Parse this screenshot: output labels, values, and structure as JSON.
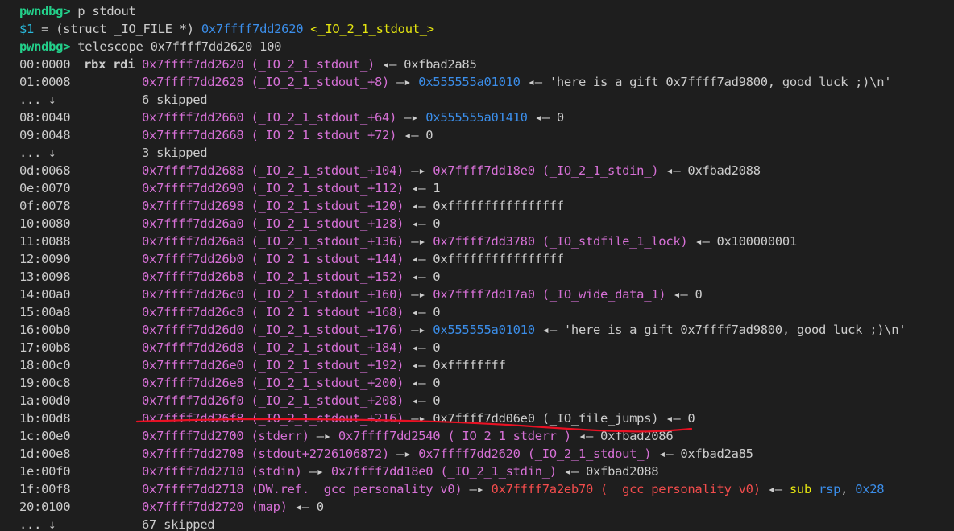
{
  "header": {
    "cmd1_prompt": "pwndbg>",
    "cmd1_text": " p stdout",
    "result_var": "$1",
    "result_mid": " = (struct _IO_FILE *) ",
    "result_addr": "0x7ffff7dd2620",
    "result_sym": " <_IO_2_1_stdout_>",
    "cmd2_prompt": "pwndbg>",
    "cmd2_text": " telescope 0x7ffff7dd2620 100"
  },
  "rows": [
    {
      "idx": "00:0000",
      "regs": "rbx rdi",
      "parts": [
        [
          "mag",
          "0x7ffff7dd2620 (_IO_2_1_stdout_)"
        ],
        [
          "white",
          " ◂— 0xfbad2a85"
        ]
      ]
    },
    {
      "idx": "01:0008",
      "regs": "",
      "parts": [
        [
          "mag",
          "0x7ffff7dd2628 (_IO_2_1_stdout_+8)"
        ],
        [
          "white",
          " —▸ "
        ],
        [
          "blue",
          "0x555555a01010"
        ],
        [
          "white",
          " ◂— 'here is a gift 0x7ffff7ad9800, good luck ;)\\n'"
        ]
      ]
    },
    {
      "idx": "... ↓",
      "skip": true,
      "parts": [
        [
          "white",
          "6 skipped"
        ]
      ]
    },
    {
      "idx": "08:0040",
      "regs": "",
      "parts": [
        [
          "mag",
          "0x7ffff7dd2660 (_IO_2_1_stdout_+64)"
        ],
        [
          "white",
          " —▸ "
        ],
        [
          "blue",
          "0x555555a01410"
        ],
        [
          "white",
          " ◂— 0"
        ]
      ]
    },
    {
      "idx": "09:0048",
      "regs": "",
      "parts": [
        [
          "mag",
          "0x7ffff7dd2668 (_IO_2_1_stdout_+72)"
        ],
        [
          "white",
          " ◂— 0"
        ]
      ]
    },
    {
      "idx": "... ↓",
      "skip": true,
      "parts": [
        [
          "white",
          "3 skipped"
        ]
      ]
    },
    {
      "idx": "0d:0068",
      "regs": "",
      "parts": [
        [
          "mag",
          "0x7ffff7dd2688 (_IO_2_1_stdout_+104)"
        ],
        [
          "white",
          " —▸ "
        ],
        [
          "mag",
          "0x7ffff7dd18e0 (_IO_2_1_stdin_)"
        ],
        [
          "white",
          " ◂— 0xfbad2088"
        ]
      ]
    },
    {
      "idx": "0e:0070",
      "regs": "",
      "parts": [
        [
          "mag",
          "0x7ffff7dd2690 (_IO_2_1_stdout_+112)"
        ],
        [
          "white",
          " ◂— 1"
        ]
      ]
    },
    {
      "idx": "0f:0078",
      "regs": "",
      "parts": [
        [
          "mag",
          "0x7ffff7dd2698 (_IO_2_1_stdout_+120)"
        ],
        [
          "white",
          " ◂— 0xffffffffffffffff"
        ]
      ]
    },
    {
      "idx": "10:0080",
      "regs": "",
      "parts": [
        [
          "mag",
          "0x7ffff7dd26a0 (_IO_2_1_stdout_+128)"
        ],
        [
          "white",
          " ◂— 0"
        ]
      ]
    },
    {
      "idx": "11:0088",
      "regs": "",
      "parts": [
        [
          "mag",
          "0x7ffff7dd26a8 (_IO_2_1_stdout_+136)"
        ],
        [
          "white",
          " —▸ "
        ],
        [
          "mag",
          "0x7ffff7dd3780 (_IO_stdfile_1_lock)"
        ],
        [
          "white",
          " ◂— 0x100000001"
        ]
      ]
    },
    {
      "idx": "12:0090",
      "regs": "",
      "parts": [
        [
          "mag",
          "0x7ffff7dd26b0 (_IO_2_1_stdout_+144)"
        ],
        [
          "white",
          " ◂— 0xffffffffffffffff"
        ]
      ]
    },
    {
      "idx": "13:0098",
      "regs": "",
      "parts": [
        [
          "mag",
          "0x7ffff7dd26b8 (_IO_2_1_stdout_+152)"
        ],
        [
          "white",
          " ◂— 0"
        ]
      ]
    },
    {
      "idx": "14:00a0",
      "regs": "",
      "parts": [
        [
          "mag",
          "0x7ffff7dd26c0 (_IO_2_1_stdout_+160)"
        ],
        [
          "white",
          " —▸ "
        ],
        [
          "mag",
          "0x7ffff7dd17a0 (_IO_wide_data_1)"
        ],
        [
          "white",
          " ◂— 0"
        ]
      ]
    },
    {
      "idx": "15:00a8",
      "regs": "",
      "parts": [
        [
          "mag",
          "0x7ffff7dd26c8 (_IO_2_1_stdout_+168)"
        ],
        [
          "white",
          " ◂— 0"
        ]
      ]
    },
    {
      "idx": "16:00b0",
      "regs": "",
      "parts": [
        [
          "mag",
          "0x7ffff7dd26d0 (_IO_2_1_stdout_+176)"
        ],
        [
          "white",
          " —▸ "
        ],
        [
          "blue",
          "0x555555a01010"
        ],
        [
          "white",
          " ◂— 'here is a gift 0x7ffff7ad9800, good luck ;)\\n'"
        ]
      ]
    },
    {
      "idx": "17:00b8",
      "regs": "",
      "parts": [
        [
          "mag",
          "0x7ffff7dd26d8 (_IO_2_1_stdout_+184)"
        ],
        [
          "white",
          " ◂— 0"
        ]
      ]
    },
    {
      "idx": "18:00c0",
      "regs": "",
      "parts": [
        [
          "mag",
          "0x7ffff7dd26e0 (_IO_2_1_stdout_+192)"
        ],
        [
          "white",
          " ◂— 0xffffffff"
        ]
      ]
    },
    {
      "idx": "19:00c8",
      "regs": "",
      "parts": [
        [
          "mag",
          "0x7ffff7dd26e8 (_IO_2_1_stdout_+200)"
        ],
        [
          "white",
          " ◂— 0"
        ]
      ]
    },
    {
      "idx": "1a:00d0",
      "regs": "",
      "parts": [
        [
          "mag",
          "0x7ffff7dd26f0 (_IO_2_1_stdout_+208)"
        ],
        [
          "white",
          " ◂— 0"
        ]
      ]
    },
    {
      "idx": "1b:00d8",
      "regs": "",
      "highlight": true,
      "parts": [
        [
          "mag",
          "0x7ffff7dd26f8 (_IO_2_1_stdout_+216)"
        ],
        [
          "white",
          " —▸ 0x7ffff7dd06e0 (_IO_file_jumps) ◂— 0"
        ]
      ]
    },
    {
      "idx": "1c:00e0",
      "regs": "",
      "parts": [
        [
          "mag",
          "0x7ffff7dd2700 (stderr)"
        ],
        [
          "white",
          " —▸ "
        ],
        [
          "mag",
          "0x7ffff7dd2540 (_IO_2_1_stderr_)"
        ],
        [
          "white",
          " ◂— 0xfbad2086"
        ]
      ]
    },
    {
      "idx": "1d:00e8",
      "regs": "",
      "parts": [
        [
          "mag",
          "0x7ffff7dd2708 (stdout+2726106872)"
        ],
        [
          "white",
          " —▸ "
        ],
        [
          "mag",
          "0x7ffff7dd2620 (_IO_2_1_stdout_)"
        ],
        [
          "white",
          " ◂— 0xfbad2a85"
        ]
      ]
    },
    {
      "idx": "1e:00f0",
      "regs": "",
      "parts": [
        [
          "mag",
          "0x7ffff7dd2710 (stdin)"
        ],
        [
          "white",
          " —▸ "
        ],
        [
          "mag",
          "0x7ffff7dd18e0 (_IO_2_1_stdin_)"
        ],
        [
          "white",
          " ◂— 0xfbad2088"
        ]
      ]
    },
    {
      "idx": "1f:00f8",
      "regs": "",
      "parts": [
        [
          "mag",
          "0x7ffff7dd2718 (DW.ref.__gcc_personality_v0)"
        ],
        [
          "white",
          " —▸ "
        ],
        [
          "red",
          "0x7ffff7a2eb70 (__gcc_personality_v0)"
        ],
        [
          "white",
          " ◂— "
        ],
        [
          "yel",
          "sub "
        ],
        [
          "blue",
          "rsp"
        ],
        [
          "white",
          ", "
        ],
        [
          "blue",
          "0x28"
        ]
      ]
    },
    {
      "idx": "20:0100",
      "regs": "",
      "parts": [
        [
          "mag",
          "0x7ffff7dd2720 (map)"
        ],
        [
          "white",
          " ◂— 0"
        ]
      ]
    },
    {
      "idx": "... ↓",
      "skip": true,
      "parts": [
        [
          "white",
          "67 skipped"
        ]
      ]
    }
  ],
  "colors": {
    "background": "#1e1e1e",
    "prompt": "#23d18b",
    "magenta": "#d670d6",
    "blue": "#3b8eea",
    "yellow": "#e5e510",
    "red": "#f14c4c",
    "white": "#cccccc",
    "annotation": "#e81123"
  }
}
